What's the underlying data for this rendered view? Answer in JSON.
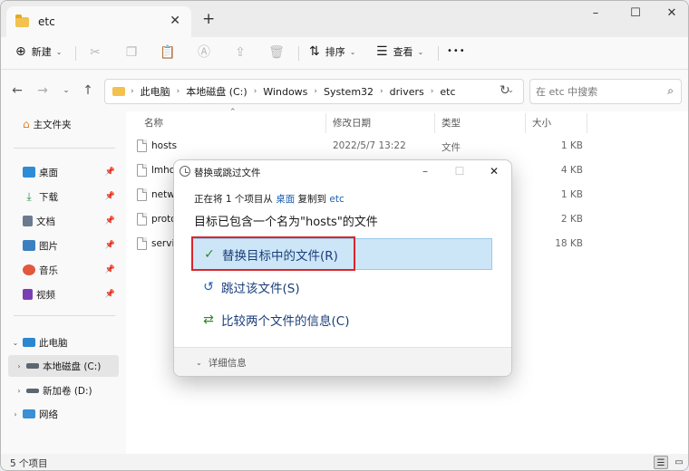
{
  "window": {
    "tab_title": "etc",
    "new_tab": "+",
    "minimize": "–",
    "maximize": "☐",
    "close": "✕"
  },
  "commandbar": {
    "new": "新建",
    "sort": "排序",
    "view": "查看",
    "more": "•••"
  },
  "address": {
    "breadcrumbs": [
      "此电脑",
      "本地磁盘 (C:)",
      "Windows",
      "System32",
      "drivers",
      "etc"
    ],
    "search_placeholder": "在 etc 中搜索"
  },
  "sidebar": {
    "home": "主文件夹",
    "quick": [
      {
        "label": "桌面",
        "icon": "desktop-icon",
        "color": "#2f8bd6"
      },
      {
        "label": "下载",
        "icon": "download-icon",
        "color": "#2d8a4e"
      },
      {
        "label": "文档",
        "icon": "document-icon",
        "color": "#6b7a8f"
      },
      {
        "label": "图片",
        "icon": "pictures-icon",
        "color": "#3c7fc1"
      },
      {
        "label": "音乐",
        "icon": "music-icon",
        "color": "#e2573d"
      },
      {
        "label": "视频",
        "icon": "video-icon",
        "color": "#7a3fb5"
      }
    ],
    "this_pc": "此电脑",
    "drives": [
      {
        "label": "本地磁盘 (C:)",
        "selected": true
      },
      {
        "label": "新加卷 (D:)",
        "selected": false
      }
    ],
    "network": "网络"
  },
  "filelist": {
    "columns": [
      "名称",
      "修改日期",
      "类型",
      "大小"
    ],
    "rows": [
      {
        "name": "hosts",
        "date": "2022/5/7 13:22",
        "type": "文件",
        "size": "1 KB"
      },
      {
        "name": "lmho",
        "date": "",
        "type": "",
        "size": "4 KB"
      },
      {
        "name": "netw",
        "date": "",
        "type": "",
        "size": "1 KB"
      },
      {
        "name": "proto",
        "date": "",
        "type": "",
        "size": "2 KB"
      },
      {
        "name": "servic",
        "date": "",
        "type": "",
        "size": "18 KB"
      }
    ]
  },
  "status": {
    "item_count": "5 个项目"
  },
  "dialog": {
    "title": "替换或跳过文件",
    "copy_prefix": "正在将 1 个项目从",
    "copy_from": "桌面",
    "copy_mid": "复制到",
    "copy_to": "etc",
    "heading": "目标已包含一个名为\"hosts\"的文件",
    "option_replace": "替换目标中的文件(R)",
    "option_skip": "跳过该文件(S)",
    "option_compare": "比较两个文件的信息(C)",
    "more_details": "详细信息",
    "accent": "#cde6f7",
    "highlight_box": "#d9262b"
  }
}
